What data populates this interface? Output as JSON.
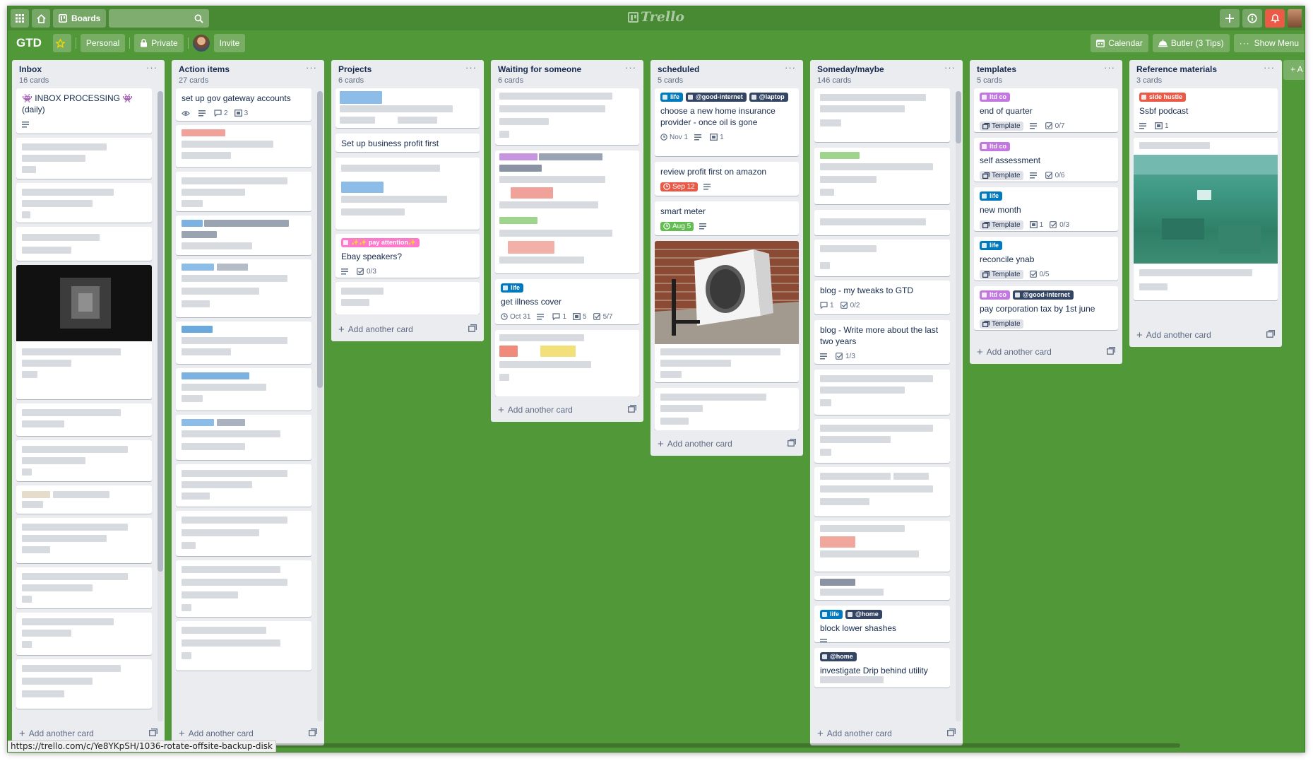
{
  "header": {
    "boards_label": "Boards",
    "logo_text": "Trello"
  },
  "board": {
    "title": "GTD",
    "team_label": "Personal",
    "visibility_label": "Private",
    "invite_label": "Invite",
    "calendar_label": "Calendar",
    "butler_label": "Butler (3 Tips)",
    "menu_label": "Show Menu",
    "add_list_label": "+ A"
  },
  "colors": {
    "board_bg": "#519839",
    "label_blue": "#0079bf",
    "label_purple": "#c377e0",
    "label_black": "#344563",
    "label_red": "#eb5a46",
    "label_pink": "#ff78cb",
    "due_red": "#eb5a46",
    "due_green": "#61bd4f"
  },
  "lists": [
    {
      "name": "Inbox",
      "count": "16 cards",
      "add_label": "Add another card",
      "cards": [
        {
          "title": "👾 INBOX PROCESSING 👾 (daily)",
          "has_description": true
        }
      ]
    },
    {
      "name": "Action items",
      "count": "27 cards",
      "add_label": "Add another card",
      "cards": [
        {
          "title": "set up gov gateway accounts",
          "watching": true,
          "has_description": true,
          "comments": "2",
          "attachments": "3"
        }
      ]
    },
    {
      "name": "Projects",
      "count": "6 cards",
      "add_label": "Add another card",
      "cards": [
        {
          "title": "Set up business profit first"
        },
        {
          "labels": [
            {
              "text": "✨✨ pay attention✨",
              "color": "#ff78cb"
            }
          ],
          "title": "Ebay speakers?",
          "has_description": true,
          "checklist": "0/3"
        }
      ]
    },
    {
      "name": "Waiting for someone",
      "count": "6 cards",
      "add_label": "Add another card",
      "cards": [
        {
          "labels": [
            {
              "text": "life",
              "color": "#0079bf"
            }
          ],
          "title": "get illness cover",
          "due": "Oct 31",
          "has_description": true,
          "comments": "1",
          "attachments": "5",
          "checklist": "5/7"
        }
      ]
    },
    {
      "name": "scheduled",
      "count": "5 cards",
      "add_label": "Add another card",
      "cards": [
        {
          "labels": [
            {
              "text": "life",
              "color": "#0079bf"
            },
            {
              "text": "@good-internet",
              "color": "#344563"
            },
            {
              "text": "@laptop",
              "color": "#344563"
            }
          ],
          "title": "choose a new home insurance provider - once oil is gone",
          "due": "Nov 1",
          "has_description": true,
          "attachments": "1"
        },
        {
          "title": "review profit first on amazon",
          "due": "Sep 12",
          "due_color": "#eb5a46",
          "has_description": true
        },
        {
          "title": "smart meter",
          "due": "Aug 5",
          "due_color": "#61bd4f",
          "has_description": true
        }
      ]
    },
    {
      "name": "Someday/maybe",
      "count": "146 cards",
      "add_label": "Add another card",
      "cards": [
        {
          "title": "blog - my tweaks to GTD",
          "comments": "1",
          "checklist": "0/2"
        },
        {
          "title": "blog - Write more about the last two years",
          "has_description": true,
          "checklist": "1/3"
        },
        {
          "labels": [
            {
              "text": "life",
              "color": "#0079bf"
            },
            {
              "text": "@home",
              "color": "#344563"
            }
          ],
          "title": "block lower shashes",
          "has_description": true
        },
        {
          "labels": [
            {
              "text": "@home",
              "color": "#344563"
            }
          ],
          "title": "investigate Drip behind utility"
        }
      ]
    },
    {
      "name": "templates",
      "count": "5 cards",
      "add_label": "Add another card",
      "cards": [
        {
          "labels": [
            {
              "text": "ltd co",
              "color": "#c377e0"
            }
          ],
          "title": "end of quarter",
          "template": "Template",
          "has_description": true,
          "checklist": "0/7"
        },
        {
          "labels": [
            {
              "text": "ltd co",
              "color": "#c377e0"
            }
          ],
          "title": "self assessment",
          "template": "Template",
          "has_description": true,
          "checklist": "0/6"
        },
        {
          "labels": [
            {
              "text": "life",
              "color": "#0079bf"
            }
          ],
          "title": "new month",
          "template": "Template",
          "attachments": "1",
          "checklist": "0/3"
        },
        {
          "labels": [
            {
              "text": "life",
              "color": "#0079bf"
            }
          ],
          "title": "reconcile ynab",
          "template": "Template",
          "checklist": "0/5"
        },
        {
          "labels": [
            {
              "text": "ltd co",
              "color": "#c377e0"
            },
            {
              "text": "@good-internet",
              "color": "#344563"
            }
          ],
          "title": "pay corporation tax by 1st june",
          "template": "Template"
        }
      ]
    },
    {
      "name": "Reference materials",
      "count": "3 cards",
      "add_label": "Add another card",
      "cards": [
        {
          "labels": [
            {
              "text": "side hustle",
              "color": "#eb5a46"
            }
          ],
          "title": "Ssbf podcast",
          "has_description": true,
          "attachments": "1"
        }
      ]
    }
  ],
  "status_url": "https://trello.com/c/Ye8YKpSH/1036-rotate-offsite-backup-disk"
}
